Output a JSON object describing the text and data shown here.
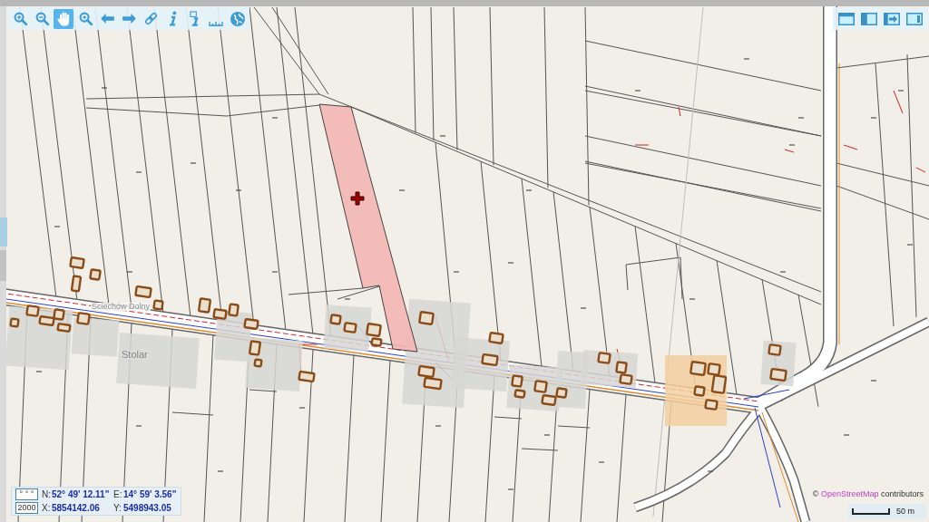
{
  "toolbar": {
    "tools": [
      {
        "kind": "zoom-in",
        "selected": false
      },
      {
        "kind": "zoom-out",
        "selected": false
      },
      {
        "kind": "pan",
        "selected": true
      },
      {
        "kind": "zoom-box",
        "selected": false
      },
      {
        "kind": "back",
        "selected": false
      },
      {
        "kind": "forward",
        "selected": false
      },
      {
        "kind": "link",
        "selected": false
      },
      {
        "kind": "info",
        "selected": false
      },
      {
        "kind": "info-box",
        "selected": false
      },
      {
        "kind": "measure",
        "selected": false
      },
      {
        "kind": "globe",
        "selected": false
      }
    ]
  },
  "map": {
    "labels": [
      {
        "text": "Ściechów Dolny",
        "kind": "locality"
      },
      {
        "text": "Stolar",
        "kind": "place"
      }
    ]
  },
  "coordinates": {
    "buttons": [
      "° ° °",
      "2000"
    ],
    "rows": [
      [
        {
          "axis": "N:",
          "value": "52° 49' 12.11\""
        },
        {
          "axis": "E:",
          "value": "14° 59' 3.56\""
        }
      ],
      [
        {
          "axis": "X:",
          "value": "5854142.06"
        },
        {
          "axis": "Y:",
          "value": "5498943.05"
        }
      ]
    ]
  },
  "attribution": {
    "symbol": "©",
    "link": "OpenStreetMap",
    "text": "contributors"
  },
  "scale": {
    "label": "50 m"
  }
}
